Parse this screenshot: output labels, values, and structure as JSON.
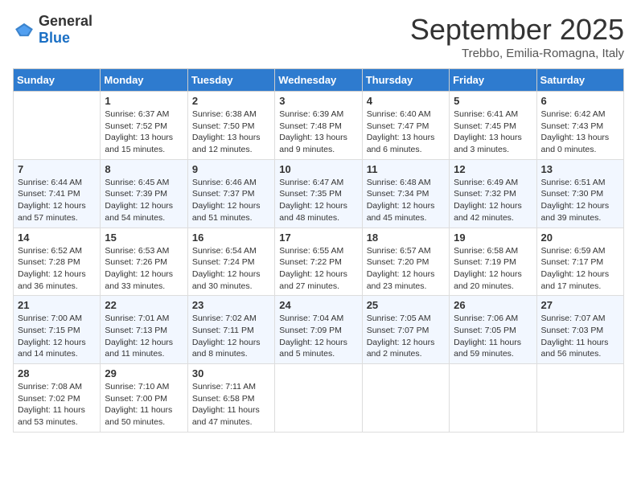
{
  "header": {
    "logo_general": "General",
    "logo_blue": "Blue",
    "month_title": "September 2025",
    "location": "Trebbo, Emilia-Romagna, Italy"
  },
  "weekdays": [
    "Sunday",
    "Monday",
    "Tuesday",
    "Wednesday",
    "Thursday",
    "Friday",
    "Saturday"
  ],
  "weeks": [
    [
      {
        "day": "",
        "info": ""
      },
      {
        "day": "1",
        "info": "Sunrise: 6:37 AM\nSunset: 7:52 PM\nDaylight: 13 hours\nand 15 minutes."
      },
      {
        "day": "2",
        "info": "Sunrise: 6:38 AM\nSunset: 7:50 PM\nDaylight: 13 hours\nand 12 minutes."
      },
      {
        "day": "3",
        "info": "Sunrise: 6:39 AM\nSunset: 7:48 PM\nDaylight: 13 hours\nand 9 minutes."
      },
      {
        "day": "4",
        "info": "Sunrise: 6:40 AM\nSunset: 7:47 PM\nDaylight: 13 hours\nand 6 minutes."
      },
      {
        "day": "5",
        "info": "Sunrise: 6:41 AM\nSunset: 7:45 PM\nDaylight: 13 hours\nand 3 minutes."
      },
      {
        "day": "6",
        "info": "Sunrise: 6:42 AM\nSunset: 7:43 PM\nDaylight: 13 hours\nand 0 minutes."
      }
    ],
    [
      {
        "day": "7",
        "info": "Sunrise: 6:44 AM\nSunset: 7:41 PM\nDaylight: 12 hours\nand 57 minutes."
      },
      {
        "day": "8",
        "info": "Sunrise: 6:45 AM\nSunset: 7:39 PM\nDaylight: 12 hours\nand 54 minutes."
      },
      {
        "day": "9",
        "info": "Sunrise: 6:46 AM\nSunset: 7:37 PM\nDaylight: 12 hours\nand 51 minutes."
      },
      {
        "day": "10",
        "info": "Sunrise: 6:47 AM\nSunset: 7:35 PM\nDaylight: 12 hours\nand 48 minutes."
      },
      {
        "day": "11",
        "info": "Sunrise: 6:48 AM\nSunset: 7:34 PM\nDaylight: 12 hours\nand 45 minutes."
      },
      {
        "day": "12",
        "info": "Sunrise: 6:49 AM\nSunset: 7:32 PM\nDaylight: 12 hours\nand 42 minutes."
      },
      {
        "day": "13",
        "info": "Sunrise: 6:51 AM\nSunset: 7:30 PM\nDaylight: 12 hours\nand 39 minutes."
      }
    ],
    [
      {
        "day": "14",
        "info": "Sunrise: 6:52 AM\nSunset: 7:28 PM\nDaylight: 12 hours\nand 36 minutes."
      },
      {
        "day": "15",
        "info": "Sunrise: 6:53 AM\nSunset: 7:26 PM\nDaylight: 12 hours\nand 33 minutes."
      },
      {
        "day": "16",
        "info": "Sunrise: 6:54 AM\nSunset: 7:24 PM\nDaylight: 12 hours\nand 30 minutes."
      },
      {
        "day": "17",
        "info": "Sunrise: 6:55 AM\nSunset: 7:22 PM\nDaylight: 12 hours\nand 27 minutes."
      },
      {
        "day": "18",
        "info": "Sunrise: 6:57 AM\nSunset: 7:20 PM\nDaylight: 12 hours\nand 23 minutes."
      },
      {
        "day": "19",
        "info": "Sunrise: 6:58 AM\nSunset: 7:19 PM\nDaylight: 12 hours\nand 20 minutes."
      },
      {
        "day": "20",
        "info": "Sunrise: 6:59 AM\nSunset: 7:17 PM\nDaylight: 12 hours\nand 17 minutes."
      }
    ],
    [
      {
        "day": "21",
        "info": "Sunrise: 7:00 AM\nSunset: 7:15 PM\nDaylight: 12 hours\nand 14 minutes."
      },
      {
        "day": "22",
        "info": "Sunrise: 7:01 AM\nSunset: 7:13 PM\nDaylight: 12 hours\nand 11 minutes."
      },
      {
        "day": "23",
        "info": "Sunrise: 7:02 AM\nSunset: 7:11 PM\nDaylight: 12 hours\nand 8 minutes."
      },
      {
        "day": "24",
        "info": "Sunrise: 7:04 AM\nSunset: 7:09 PM\nDaylight: 12 hours\nand 5 minutes."
      },
      {
        "day": "25",
        "info": "Sunrise: 7:05 AM\nSunset: 7:07 PM\nDaylight: 12 hours\nand 2 minutes."
      },
      {
        "day": "26",
        "info": "Sunrise: 7:06 AM\nSunset: 7:05 PM\nDaylight: 11 hours\nand 59 minutes."
      },
      {
        "day": "27",
        "info": "Sunrise: 7:07 AM\nSunset: 7:03 PM\nDaylight: 11 hours\nand 56 minutes."
      }
    ],
    [
      {
        "day": "28",
        "info": "Sunrise: 7:08 AM\nSunset: 7:02 PM\nDaylight: 11 hours\nand 53 minutes."
      },
      {
        "day": "29",
        "info": "Sunrise: 7:10 AM\nSunset: 7:00 PM\nDaylight: 11 hours\nand 50 minutes."
      },
      {
        "day": "30",
        "info": "Sunrise: 7:11 AM\nSunset: 6:58 PM\nDaylight: 11 hours\nand 47 minutes."
      },
      {
        "day": "",
        "info": ""
      },
      {
        "day": "",
        "info": ""
      },
      {
        "day": "",
        "info": ""
      },
      {
        "day": "",
        "info": ""
      }
    ]
  ]
}
